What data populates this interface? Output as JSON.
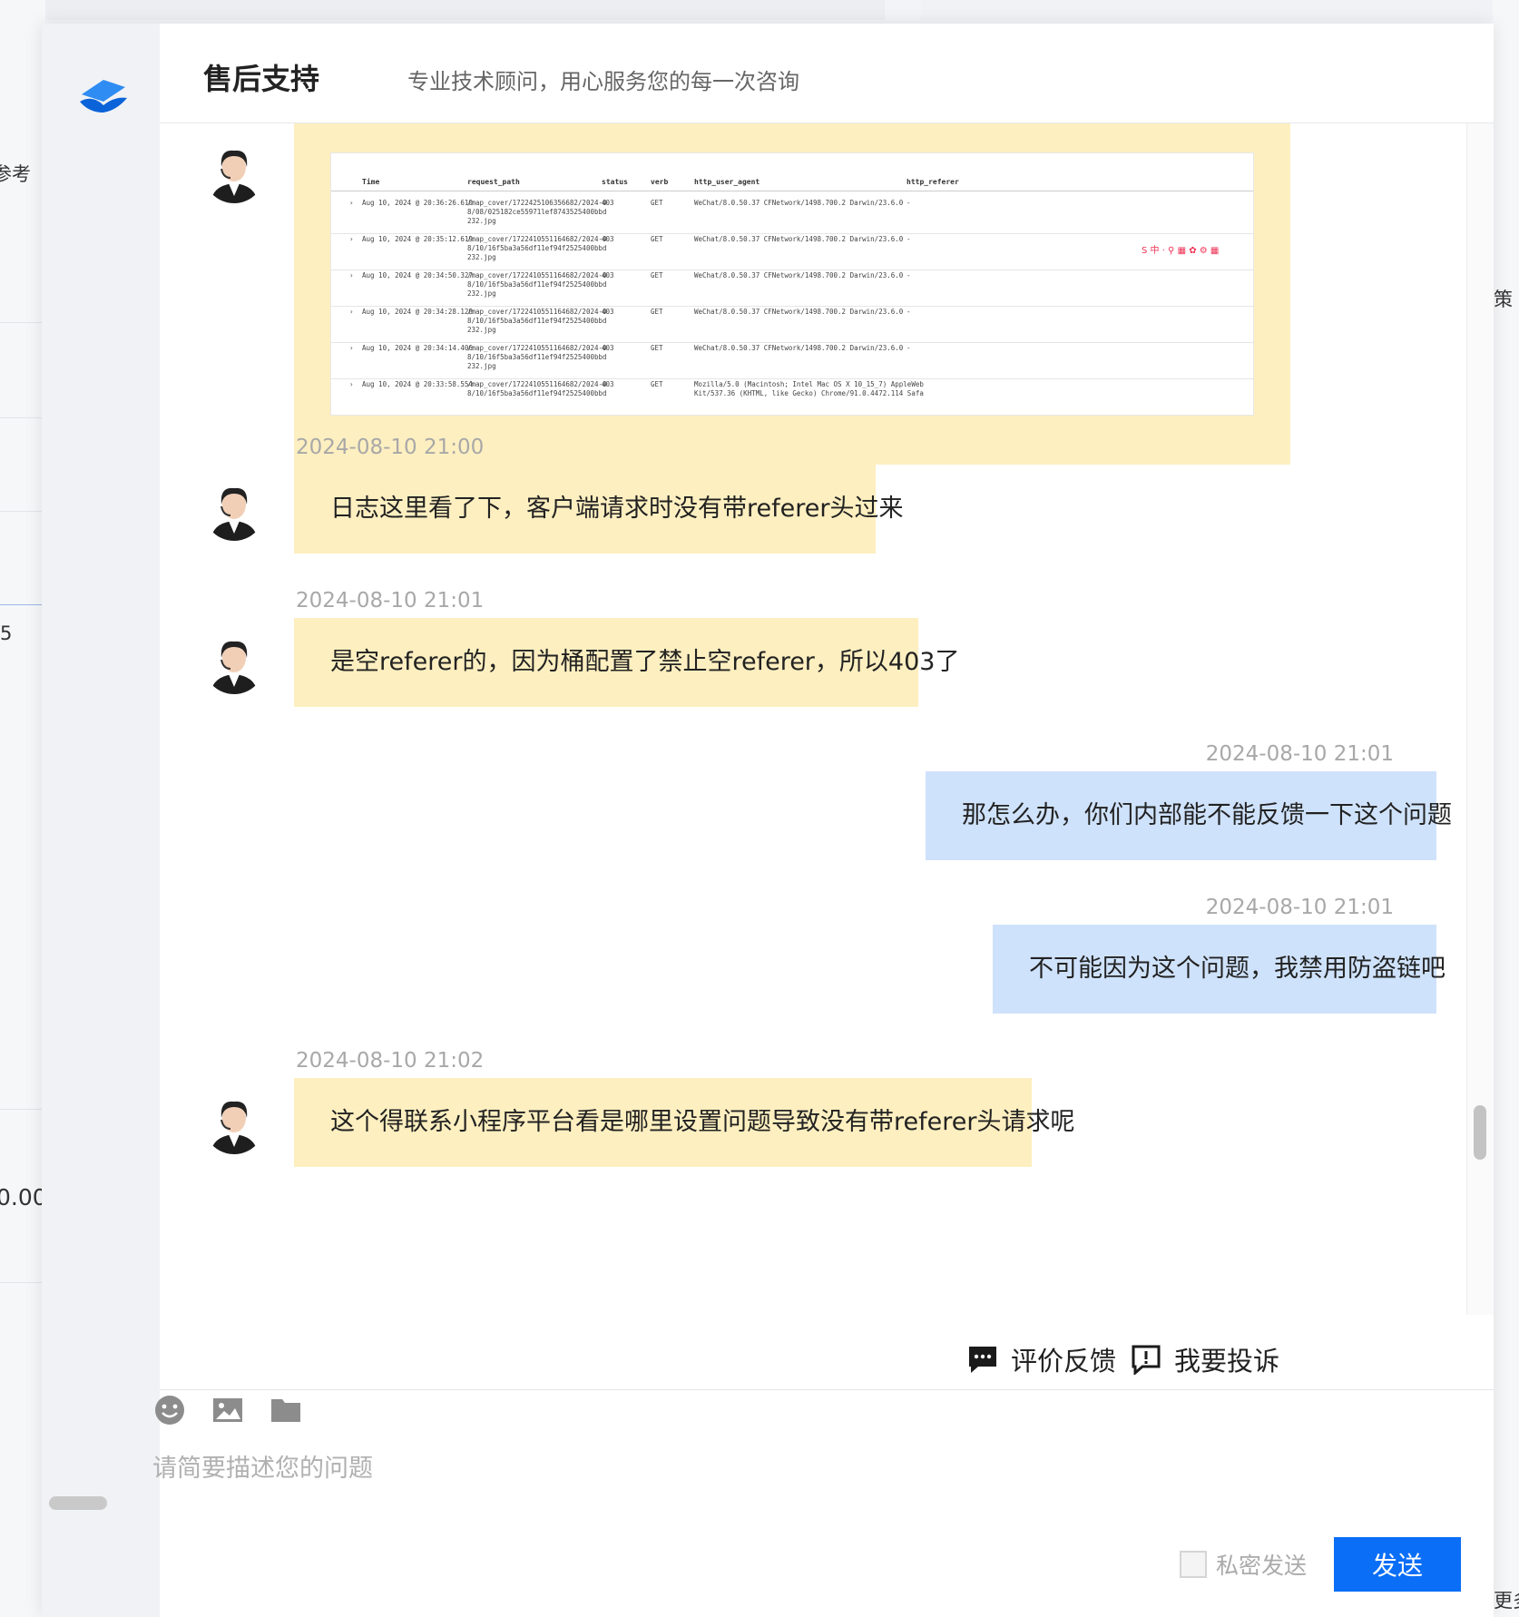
{
  "background": {
    "fragment_1": "参考",
    "fragment_2": "5",
    "fragment_3": "0.00",
    "fragment_4": "策",
    "fragment_5": "更多"
  },
  "header": {
    "title": "售后支持",
    "subtitle": "专业技术顾问，用心服务您的每一次咨询"
  },
  "screenshot_table": {
    "columns": [
      "Time",
      "request_path",
      "status",
      "verb",
      "http_user_agent",
      "http_referer"
    ],
    "rows": [
      [
        "Aug 10, 2024 @ 20:36:26.610",
        "/map_cover/1722425106356682/2024-0\n8/08/025182ce55971lef8743525400bbd\n232.jpg",
        "403",
        "GET",
        "WeChat/8.0.50.37 CFNetwork/1498.700.2 Darwin/23.6.0",
        "-"
      ],
      [
        "Aug 10, 2024 @ 20:35:12.619",
        "/map_cover/1722410551164682/2024-0\n8/10/16f5ba3a56df11ef94f2525400bbd\n232.jpg",
        "403",
        "GET",
        "WeChat/8.0.50.37 CFNetwork/1498.700.2 Darwin/23.6.0",
        "-"
      ],
      [
        "Aug 10, 2024 @ 20:34:50.327",
        "/map_cover/1722410551164682/2024-0\n8/10/16f5ba3a56df11ef94f2525400bbd\n232.jpg",
        "403",
        "GET",
        "WeChat/8.0.50.37 CFNetwork/1498.700.2 Darwin/23.6.0",
        "-"
      ],
      [
        "Aug 10, 2024 @ 20:34:28.128",
        "/map_cover/1722410551164682/2024-0\n8/10/16f5ba3a56df11ef94f2525400bbd\n232.jpg",
        "403",
        "GET",
        "WeChat/8.0.50.37 CFNetwork/1498.700.2 Darwin/23.6.0",
        "-"
      ],
      [
        "Aug 10, 2024 @ 20:34:14.406",
        "/map_cover/1722410551164682/2024-0\n8/10/16f5ba3a56df11ef94f2525400bbd\n232.jpg",
        "403",
        "GET",
        "WeChat/8.0.50.37 CFNetwork/1498.700.2 Darwin/23.6.0",
        "-"
      ],
      [
        "Aug 10, 2024 @ 20:33:58.554",
        "/map_cover/1722410551164682/2024-0\n8/10/16f5ba3a56df11ef94f2525400bbd",
        "403",
        "GET",
        "Mozilla/5.0 (Macintosh; Intel Mac OS X 10_15_7) AppleWeb\nKit/537.36 (KHTML, like Gecko) Chrome/91.0.4472.114 Safa",
        "-"
      ]
    ]
  },
  "messages": [
    {
      "time": "2024-08-10 21:00",
      "side": "left",
      "text": "日志这里看了下，客户端请求时没有带referer头过来"
    },
    {
      "time": "2024-08-10 21:01",
      "side": "left",
      "text": "是空referer的，因为桶配置了禁止空referer，所以403了"
    },
    {
      "time": "2024-08-10 21:01",
      "side": "right",
      "text": "那怎么办，你们内部能不能反馈一下这个问题"
    },
    {
      "time": "2024-08-10 21:01",
      "side": "right",
      "text": "不可能因为这个问题，我禁用防盗链吧"
    },
    {
      "time": "2024-08-10 21:02",
      "side": "left",
      "text": "这个得联系小程序平台看是哪里设置问题导致没有带referer头请求呢"
    }
  ],
  "actions": {
    "feedback": "评价反馈",
    "complain": "我要投诉"
  },
  "composer": {
    "placeholder": "请简要描述您的问题",
    "private_label": "私密发送",
    "send_label": "发送"
  },
  "colors": {
    "agent_bubble": "#fdefc0",
    "user_bubble": "#cfe2fb",
    "send_button": "#0a6ef7"
  }
}
